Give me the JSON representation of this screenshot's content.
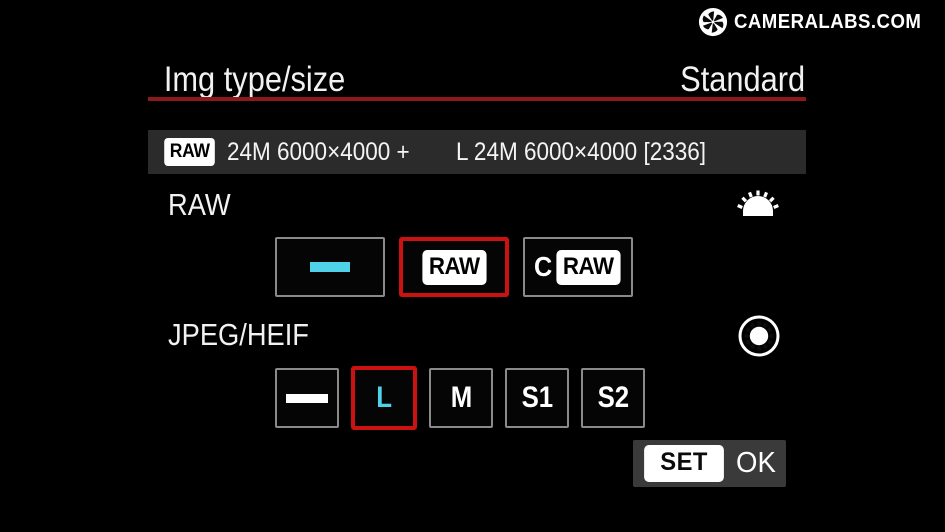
{
  "watermark": {
    "icon": "aperture-icon",
    "text": "CAMERALABS.COM"
  },
  "colors": {
    "background": "#000000",
    "header_rule": "#8c1a1a",
    "selected_border": "#cc1111",
    "highlight_cyan": "#4fd2e8",
    "info_bar_bg": "#2b2b2b",
    "button_border": "#8a8a8a",
    "set_ok_bg": "#3a3a3a"
  },
  "header": {
    "title": "Img type/size",
    "value": "Standard"
  },
  "info_bar": {
    "raw_badge": "RAW",
    "raw_detail": "24M 6000×4000 +",
    "jpeg_detail": "L  24M 6000×4000 [2336]"
  },
  "raw_section": {
    "label": "RAW",
    "dial_icon": "main-dial-icon",
    "options": [
      {
        "id": "raw-none",
        "kind": "dash",
        "label": "—",
        "dash_color": "cyan",
        "selected": false
      },
      {
        "id": "raw-raw",
        "kind": "badge",
        "label": "RAW",
        "selected": true
      },
      {
        "id": "raw-craw",
        "kind": "craw",
        "prefix": "C",
        "label": "RAW",
        "selected": false
      }
    ]
  },
  "jpeg_section": {
    "label": "JPEG/HEIF",
    "dial_icon": "quick-control-dial-icon",
    "options": [
      {
        "id": "jpeg-none",
        "kind": "dash",
        "label": "—",
        "dash_color": "white",
        "selected": false
      },
      {
        "id": "jpeg-l",
        "kind": "text",
        "label": "L",
        "text_color": "cyan",
        "selected": true
      },
      {
        "id": "jpeg-m",
        "kind": "text",
        "label": "M",
        "text_color": "white",
        "selected": false
      },
      {
        "id": "jpeg-s1",
        "kind": "text",
        "label": "S1",
        "text_color": "white",
        "selected": false
      },
      {
        "id": "jpeg-s2",
        "kind": "text",
        "label": "S2",
        "text_color": "white",
        "selected": false
      }
    ]
  },
  "footer": {
    "set_label": "SET",
    "ok_label": "OK"
  }
}
